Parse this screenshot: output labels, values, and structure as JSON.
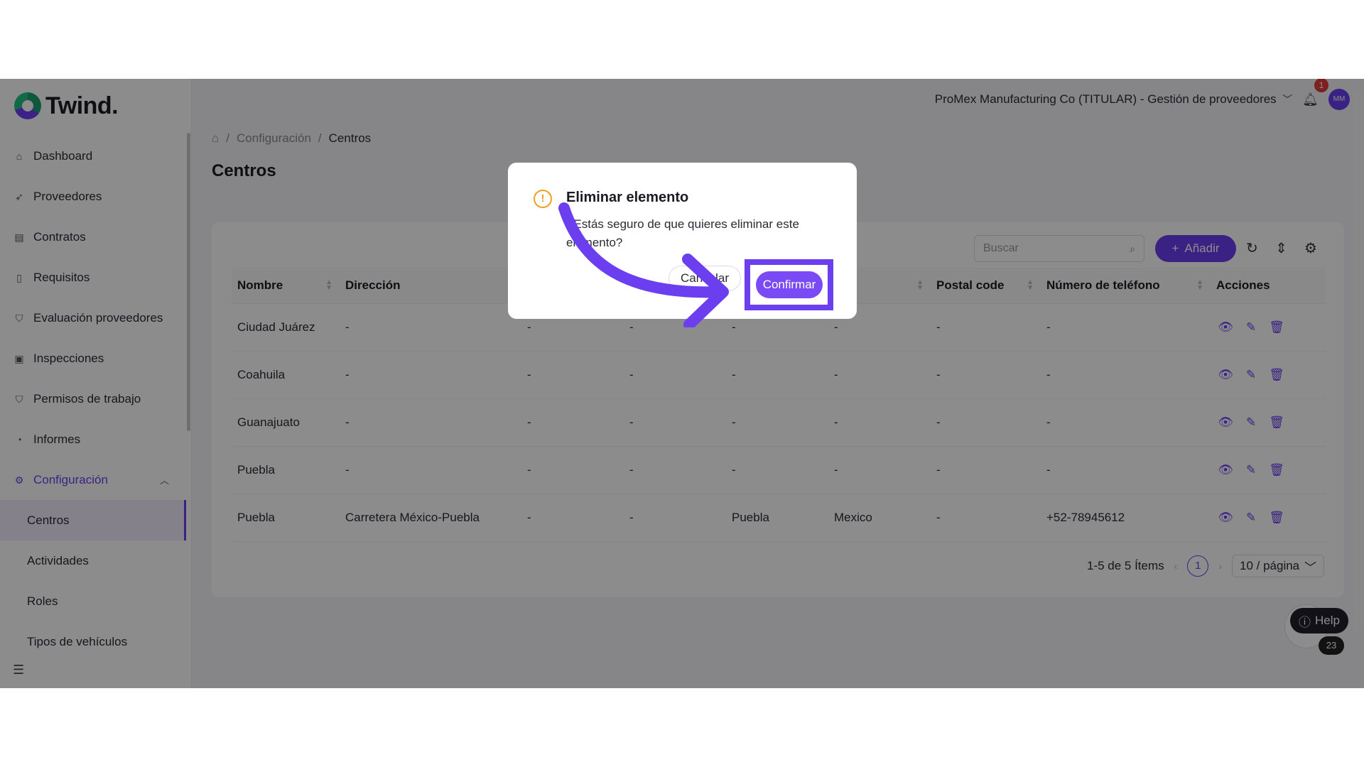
{
  "app": {
    "brand": "Twind."
  },
  "sidebar": {
    "items": [
      {
        "label": "Dashboard",
        "icon": "home-icon"
      },
      {
        "label": "Proveedores",
        "icon": "rocket-icon"
      },
      {
        "label": "Contratos",
        "icon": "contract-icon"
      },
      {
        "label": "Requisitos",
        "icon": "file-icon"
      },
      {
        "label": "Evaluación proveedores",
        "icon": "shield-check-icon"
      },
      {
        "label": "Inspecciones",
        "icon": "inspection-icon"
      },
      {
        "label": "Permisos de trabajo",
        "icon": "shield-icon"
      },
      {
        "label": "Informes",
        "icon": "pie-chart-icon"
      },
      {
        "label": "Configuración",
        "icon": "gear-icon"
      }
    ],
    "sub_items": [
      {
        "label": "Centros"
      },
      {
        "label": "Actividades"
      },
      {
        "label": "Roles"
      },
      {
        "label": "Tipos de vehículos"
      }
    ]
  },
  "header": {
    "organization": "ProMex Manufacturing Co (TITULAR) - Gestión de proveedores",
    "notifications": "1",
    "avatar": "MM"
  },
  "breadcrumb": {
    "parent": "Configuración",
    "current": "Centros"
  },
  "page": {
    "title": "Centros"
  },
  "toolbar": {
    "search_placeholder": "Buscar",
    "add_label": "Añadir"
  },
  "table": {
    "headers": [
      "Nombre",
      "Dirección",
      "",
      "",
      "",
      "",
      "Postal code",
      "Número de teléfono",
      "Acciones"
    ],
    "rows": [
      [
        "Ciudad Juárez",
        "-",
        "-",
        "-",
        "-",
        "-",
        "-",
        "-"
      ],
      [
        "Coahuila",
        "-",
        "-",
        "-",
        "-",
        "-",
        "-",
        "-"
      ],
      [
        "Guanajuato",
        "-",
        "-",
        "-",
        "-",
        "-",
        "-",
        "-"
      ],
      [
        "Puebla",
        "-",
        "-",
        "-",
        "-",
        "-",
        "-",
        "-"
      ],
      [
        "Puebla",
        "Carretera México-Puebla",
        "-",
        "-",
        "Puebla",
        "Mexico",
        "-",
        "+52-78945612"
      ]
    ]
  },
  "pagination": {
    "summary": "1-5 de 5 Ítems",
    "current_page": "1",
    "page_size": "10 / página"
  },
  "help": {
    "label": "Help",
    "count": "23"
  },
  "modal": {
    "title": "Eliminar elemento",
    "text": "¿Estás seguro de que quieres eliminar este elemento?",
    "cancel_label": "Cancelar",
    "confirm_label": "Confirmar"
  },
  "colors": {
    "accent": "#6b3ff0",
    "warning": "#f0a020"
  }
}
